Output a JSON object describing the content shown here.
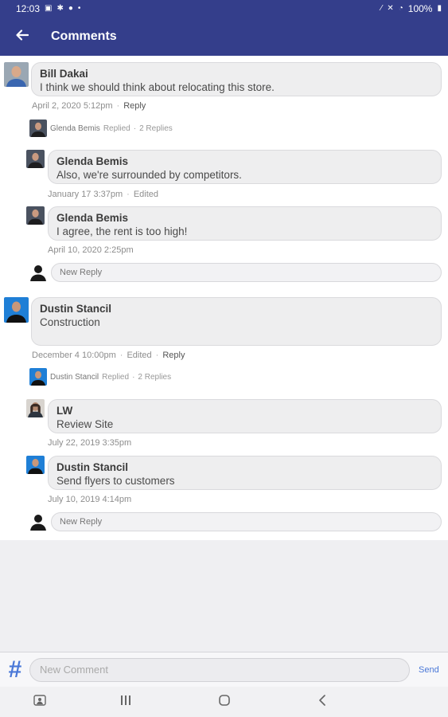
{
  "status_bar": {
    "time": "12:03",
    "battery": "100%"
  },
  "app_bar": {
    "title": "Comments"
  },
  "threads": [
    {
      "author": "Bill Dakai",
      "text": "I think we should think about relocating this store.",
      "date": "April 2, 2020 5:12pm",
      "reply_label": "Reply",
      "replied_by": "Glenda Bemis",
      "replied_label": "Replied",
      "reply_count": "2 Replies",
      "replies": [
        {
          "author": "Glenda Bemis",
          "text": "Also, we're surrounded by competitors.",
          "date": "January 17 3:37pm",
          "edited": "Edited"
        },
        {
          "author": "Glenda Bemis",
          "text": "I agree, the rent is too high!",
          "date": "April 10, 2020 2:25pm"
        }
      ],
      "new_reply_placeholder": "New Reply"
    },
    {
      "author": "Dustin Stancil",
      "text": "Construction",
      "date": "December 4 10:00pm",
      "edited": "Edited",
      "reply_label": "Reply",
      "replied_by": "Dustin Stancil",
      "replied_label": "Replied",
      "reply_count": "2 Replies",
      "replies": [
        {
          "author": "LW",
          "text": "Review Site",
          "date": "July 22, 2019 3:35pm"
        },
        {
          "author": "Dustin Stancil",
          "text": "Send flyers to customers",
          "date": "July 10, 2019 4:14pm"
        }
      ],
      "new_reply_placeholder": "New Reply"
    }
  ],
  "composer": {
    "placeholder": "New Comment",
    "send_label": "Send"
  },
  "colors": {
    "header": "#343e8b",
    "accent": "#4a78d8",
    "bubble": "#eeeeef"
  },
  "icons": [
    "back-arrow-icon",
    "hash-icon",
    "recents-icon",
    "home-icon",
    "back-nav-icon"
  ]
}
